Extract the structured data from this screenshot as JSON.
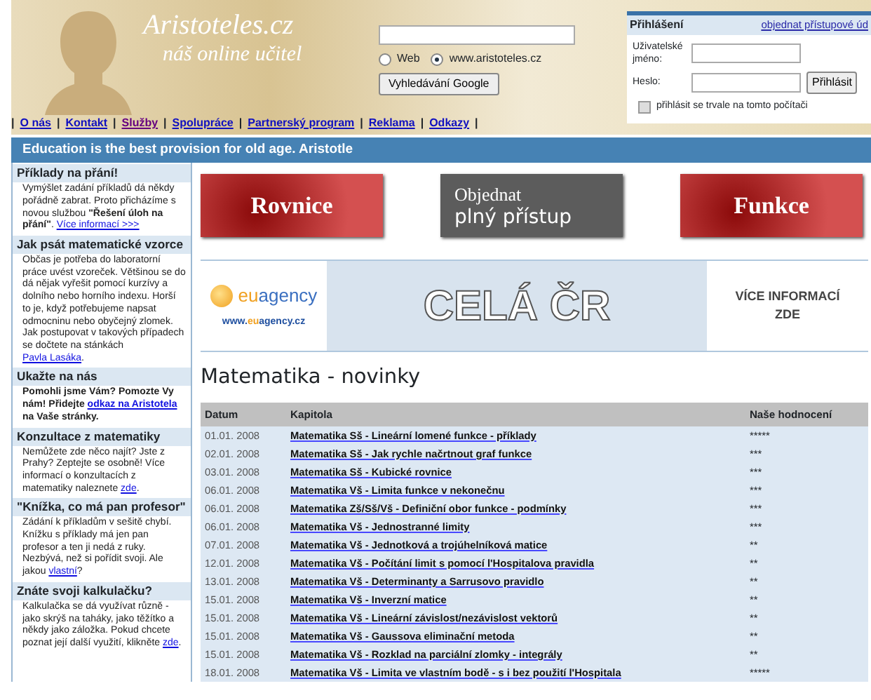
{
  "logo": {
    "title": "Aristoteles.cz",
    "subtitle": "náš online učitel"
  },
  "search": {
    "options": [
      {
        "label": "Web",
        "selected": false
      },
      {
        "label": "www.aristoteles.cz",
        "selected": true
      }
    ],
    "button": "Vyhledávání Google"
  },
  "login": {
    "title": "Přihlášení",
    "link": "objednat přístupové úd",
    "username_label": "Uživatelské jméno:",
    "password_label": "Heslo:",
    "button": "Přihlásit",
    "remember": {
      "label": "přihlásit se trvale na tomto počítači",
      "checked": false
    }
  },
  "nav": {
    "separator": "|",
    "items": [
      {
        "label": "O nás",
        "visited": false
      },
      {
        "label": "Kontakt",
        "visited": false
      },
      {
        "label": "Služby",
        "visited": true
      },
      {
        "label": "Spolupráce",
        "visited": false
      },
      {
        "label": "Partnerský program",
        "visited": false
      },
      {
        "label": "Reklama",
        "visited": false
      },
      {
        "label": "Odkazy",
        "visited": false
      }
    ]
  },
  "quote_bar": "Education is the best provision for old age. Aristotle",
  "sidebar": [
    {
      "title": "Příklady na přání!",
      "bold": false,
      "parts": [
        {
          "kind": "text",
          "text": "Vymýšlet zadání příkladů dá někdy pořádně zabrat. Proto přicházíme s novou službou "
        },
        {
          "kind": "strong",
          "text": "\"Řešení úloh na přání\""
        },
        {
          "kind": "text",
          "text": ". "
        },
        {
          "kind": "link",
          "text": "Více informací >>>"
        }
      ]
    },
    {
      "title": "Jak psát matematické vzorce",
      "bold": false,
      "parts": [
        {
          "kind": "text",
          "text": "Občas je potřeba do laboratorní práce uvést vzoreček. Většinou se do dá nějak vyřešit pomocí kurzívy a dolního nebo horního indexu. Horší to je, když potřebujeme napsat odmocninu nebo obyčejný zlomek. Jak postupovat v takových případech se dočtete na stánkách "
        },
        {
          "kind": "link",
          "text": "Pavla Lasáka"
        },
        {
          "kind": "text",
          "text": "."
        }
      ]
    },
    {
      "title": "Ukažte na nás",
      "bold": true,
      "parts": [
        {
          "kind": "text",
          "text": "Pomohli jsme Vám? Pomozte Vy nám! Přidejte "
        },
        {
          "kind": "link",
          "text": "odkaz na Aristotela"
        },
        {
          "kind": "text",
          "text": " na Vaše stránky."
        }
      ]
    },
    {
      "title": "Konzultace z matematiky",
      "bold": false,
      "parts": [
        {
          "kind": "text",
          "text": "Nemůžete zde něco najít? Jste z Prahy? Zeptejte se osobně! Více informací o konzultacích z matematiky naleznete "
        },
        {
          "kind": "link",
          "text": "zde"
        },
        {
          "kind": "text",
          "text": "."
        }
      ]
    },
    {
      "title": "\"Knížka, co má pan profesor\"",
      "bold": false,
      "parts": [
        {
          "kind": "text",
          "text": "Zádání k příkladům v sešitě chybí. Knížku s příklady má jen pan profesor a ten ji nedá z ruky. Nezbývá, než si pořídit svoji. Ale jakou "
        },
        {
          "kind": "link",
          "text": "vlastní"
        },
        {
          "kind": "text",
          "text": "?"
        }
      ]
    },
    {
      "title": "Znáte svoji kalkulačku?",
      "bold": false,
      "parts": [
        {
          "kind": "text",
          "text": "Kalkulačka se dá využívat různě - jako skrýš na taháky, jako těžítko a někdy jako záložka. Pokud chcete poznat její další využití, klikněte "
        },
        {
          "kind": "link",
          "text": "zde"
        },
        {
          "kind": "text",
          "text": "."
        }
      ]
    }
  ],
  "banners": [
    {
      "kind": "red",
      "lines": [
        "Rovnice"
      ]
    },
    {
      "kind": "gray",
      "lines": [
        "Objednat",
        "plný přístup"
      ]
    },
    {
      "kind": "red",
      "lines": [
        "Funkce"
      ]
    }
  ],
  "ad": {
    "brand": [
      {
        "text": "eu",
        "color": "#f0a020"
      },
      {
        "text": "agency",
        "color": "#3a6fc0"
      }
    ],
    "url": [
      {
        "text": "www.",
        "color": "#2050a0"
      },
      {
        "text": "eu",
        "color": "#f0a020"
      },
      {
        "text": "agency.cz",
        "color": "#2050a0"
      }
    ],
    "headline": "CELÁ ČR",
    "more": [
      "VÍCE INFORMACÍ",
      "ZDE"
    ]
  },
  "news": {
    "title": "Matematika - novinky",
    "columns": [
      "Datum",
      "Kapitola",
      "Naše hodnocení"
    ],
    "rows": [
      [
        "01.01. 2008",
        "Matematika Sš - Lineární lomené funkce - příklady",
        "*****"
      ],
      [
        "02.01. 2008",
        "Matematika Sš - Jak rychle načrtnout graf funkce",
        "***"
      ],
      [
        "03.01. 2008",
        "Matematika Sš - Kubické rovnice",
        "***"
      ],
      [
        "06.01. 2008",
        "Matematika Vš - Limita funkce v nekonečnu",
        "***"
      ],
      [
        "06.01. 2008",
        "Matematika Zš/Sš/Vš - Definiční obor funkce - podmínky",
        "***"
      ],
      [
        "06.01. 2008",
        "Matematika Vš - Jednostranné limity",
        "***"
      ],
      [
        "07.01. 2008",
        "Matematika Vš - Jednotková a trojúhelníková matice",
        "**"
      ],
      [
        "12.01. 2008",
        "Matematika Vš - Počítání limit s pomocí l'Hospitalova pravidla",
        "**"
      ],
      [
        "13.01. 2008",
        "Matematika Vš - Determinanty a Sarrusovo pravidlo",
        "**"
      ],
      [
        "15.01. 2008",
        "Matematika Vš - Inverzní matice",
        "**"
      ],
      [
        "15.01. 2008",
        "Matematika Vš - Lineární závislost/nezávislost vektorů",
        "**"
      ],
      [
        "15.01. 2008",
        "Matematika Vš - Gaussova eliminační metoda",
        "**"
      ],
      [
        "15.01. 2008",
        "Matematika Vš - Rozklad na parciální zlomky - integrály",
        "**"
      ],
      [
        "18.01. 2008",
        "Matematika Vš - Limita ve vlastním bodě - s i bez použití l'Hospitala",
        "*****"
      ]
    ]
  }
}
